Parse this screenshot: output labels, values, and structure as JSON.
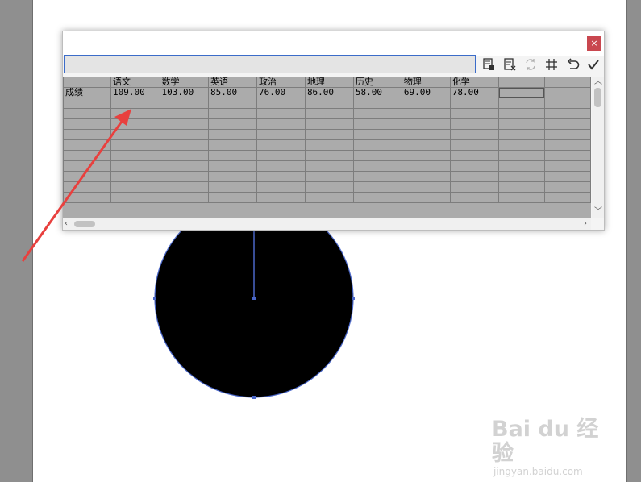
{
  "dialog": {
    "close_label": "×",
    "entry_value": "",
    "toolbar": {
      "icons": [
        "import-data-icon",
        "transpose-icon",
        "swap-xy-icon",
        "cell-style-icon",
        "revert-icon",
        "apply-icon"
      ]
    },
    "grid": {
      "headers": [
        "",
        "语文",
        "数学",
        "英语",
        "政治",
        "地理",
        "历史",
        "物理",
        "化学",
        "",
        ""
      ],
      "rows": [
        [
          "成绩",
          "109.00",
          "103.00",
          "85.00",
          "76.00",
          "86.00",
          "58.00",
          "69.00",
          "78.00",
          "",
          ""
        ]
      ]
    }
  },
  "colors": {
    "annotation_arrow": "#e8403e",
    "selection_blue": "#3b6cc9",
    "close_button": "#c9474f",
    "grid_background": "#ababab"
  },
  "watermark": {
    "main": "Bai du 经验",
    "sub": "jingyan.baidu.com"
  }
}
